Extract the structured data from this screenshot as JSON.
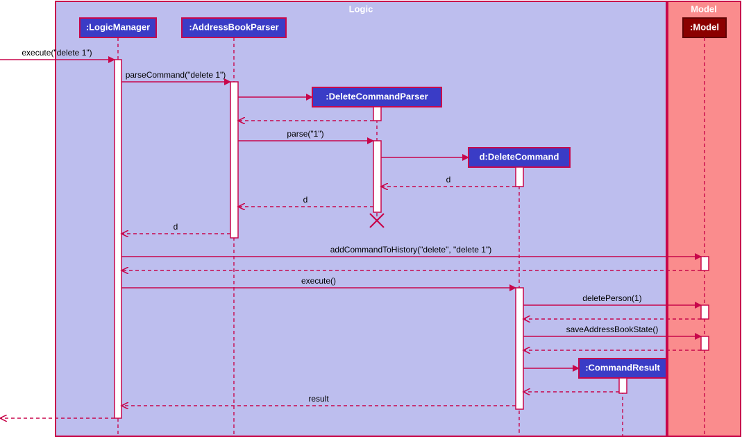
{
  "frames": {
    "logic": {
      "label": "Logic"
    },
    "model": {
      "label": "Model"
    }
  },
  "lifelines": {
    "logicManager": {
      "label": ":LogicManager"
    },
    "addressBookParser": {
      "label": ":AddressBookParser"
    },
    "deleteCommandParser": {
      "label": ":DeleteCommandParser"
    },
    "deleteCommand": {
      "label": "d:DeleteCommand"
    },
    "commandResult": {
      "label": ":CommandResult"
    },
    "modelHead": {
      "label": ":Model"
    }
  },
  "messages": {
    "m_execute_in": "execute(\"delete 1\")",
    "m_parseCommand": "parseCommand(\"delete 1\")",
    "m_parse": "parse(\"1\")",
    "m_return_d1": "d",
    "m_return_d2": "d",
    "m_return_d3": "d",
    "m_addCommandToHistory": "addCommandToHistory(\"delete\", \"delete 1\")",
    "m_execute": "execute()",
    "m_deletePerson": "deletePerson(1)",
    "m_saveAddressBookState": "saveAddressBookState()",
    "m_return_result": "result"
  },
  "chart_data": {
    "type": "uml-sequence",
    "frames": [
      "Logic",
      "Model"
    ],
    "lifelines": [
      {
        "id": "LogicManager",
        "frame": "Logic"
      },
      {
        "id": "AddressBookParser",
        "frame": "Logic"
      },
      {
        "id": "DeleteCommandParser",
        "frame": "Logic",
        "created_by": "AddressBookParser",
        "destroyed": true
      },
      {
        "id": "DeleteCommand",
        "alias": "d",
        "frame": "Logic",
        "created_by": "DeleteCommandParser"
      },
      {
        "id": "CommandResult",
        "frame": "Logic",
        "created_by": "DeleteCommand"
      },
      {
        "id": "Model",
        "frame": "Model"
      }
    ],
    "messages": [
      {
        "from": "_external_",
        "to": "LogicManager",
        "label": "execute(\"delete 1\")",
        "kind": "sync"
      },
      {
        "from": "LogicManager",
        "to": "AddressBookParser",
        "label": "parseCommand(\"delete 1\")",
        "kind": "sync"
      },
      {
        "from": "AddressBookParser",
        "to": "DeleteCommandParser",
        "label": "",
        "kind": "create"
      },
      {
        "from": "DeleteCommandParser",
        "to": "AddressBookParser",
        "label": "",
        "kind": "return"
      },
      {
        "from": "AddressBookParser",
        "to": "DeleteCommandParser",
        "label": "parse(\"1\")",
        "kind": "sync"
      },
      {
        "from": "DeleteCommandParser",
        "to": "DeleteCommand",
        "label": "",
        "kind": "create"
      },
      {
        "from": "DeleteCommand",
        "to": "DeleteCommandParser",
        "label": "d",
        "kind": "return"
      },
      {
        "from": "DeleteCommandParser",
        "to": "AddressBookParser",
        "label": "d",
        "kind": "return"
      },
      {
        "from": "DeleteCommandParser",
        "to": null,
        "label": "",
        "kind": "destroy"
      },
      {
        "from": "AddressBookParser",
        "to": "LogicManager",
        "label": "d",
        "kind": "return"
      },
      {
        "from": "LogicManager",
        "to": "Model",
        "label": "addCommandToHistory(\"delete\", \"delete 1\")",
        "kind": "sync"
      },
      {
        "from": "Model",
        "to": "LogicManager",
        "label": "",
        "kind": "return"
      },
      {
        "from": "LogicManager",
        "to": "DeleteCommand",
        "label": "execute()",
        "kind": "sync"
      },
      {
        "from": "DeleteCommand",
        "to": "Model",
        "label": "deletePerson(1)",
        "kind": "sync"
      },
      {
        "from": "Model",
        "to": "DeleteCommand",
        "label": "",
        "kind": "return"
      },
      {
        "from": "DeleteCommand",
        "to": "Model",
        "label": "saveAddressBookState()",
        "kind": "sync"
      },
      {
        "from": "Model",
        "to": "DeleteCommand",
        "label": "",
        "kind": "return"
      },
      {
        "from": "DeleteCommand",
        "to": "CommandResult",
        "label": "",
        "kind": "create"
      },
      {
        "from": "CommandResult",
        "to": "DeleteCommand",
        "label": "",
        "kind": "return"
      },
      {
        "from": "DeleteCommand",
        "to": "LogicManager",
        "label": "result",
        "kind": "return"
      },
      {
        "from": "LogicManager",
        "to": "_external_",
        "label": "",
        "kind": "return"
      }
    ]
  }
}
